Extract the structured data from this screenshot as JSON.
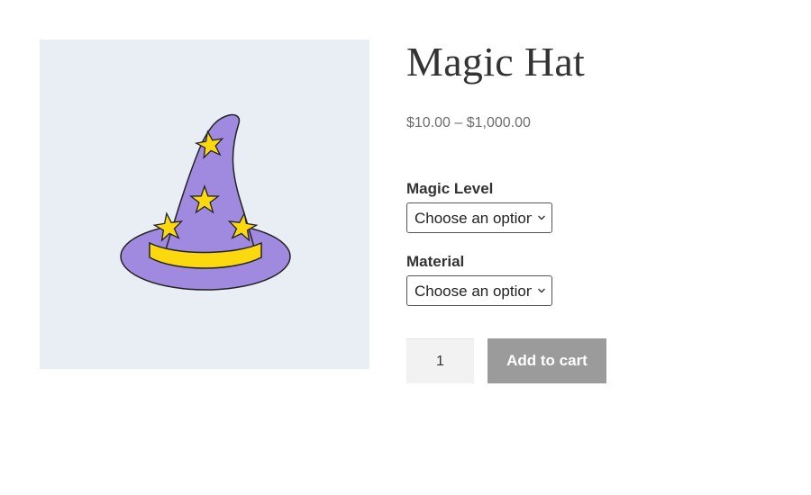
{
  "product": {
    "title": "Magic Hat",
    "price": "$10.00 – $1,000.00",
    "image_icon": "wizard-hat-image",
    "colors": {
      "hat": "#a08ae0",
      "star": "#fcd80e",
      "image_bg": "#e9eef4"
    }
  },
  "variations": {
    "magic_level": {
      "label": "Magic Level",
      "selected": "Choose an option"
    },
    "material": {
      "label": "Material",
      "selected": "Choose an option"
    }
  },
  "cart": {
    "quantity": "1",
    "add_label": "Add to cart",
    "button_color": "#9b9b9b"
  }
}
